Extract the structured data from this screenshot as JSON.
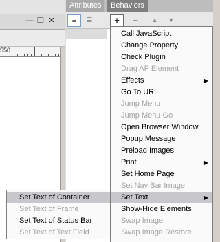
{
  "document_window": {
    "ruler_label": "550"
  },
  "window_controls": {
    "minimize": "—",
    "restore": "❐",
    "close": "✕"
  },
  "panel": {
    "tabs": [
      {
        "label": "Attributes"
      },
      {
        "label": "Behaviors"
      }
    ],
    "toolbar": {
      "show_set_events_icon": "≡",
      "show_all_events_icon": "≣",
      "add_behavior": "+",
      "remove_behavior": "–",
      "move_up": "▲",
      "move_down": "▼"
    }
  },
  "behaviors_menu": {
    "items": [
      {
        "label": "Call JavaScript",
        "disabled": false,
        "has_submenu": false
      },
      {
        "label": "Change Property",
        "disabled": false,
        "has_submenu": false
      },
      {
        "label": "Check Plugin",
        "disabled": false,
        "has_submenu": false
      },
      {
        "label": "Drag AP Element",
        "disabled": true,
        "has_submenu": false
      },
      {
        "label": "Effects",
        "disabled": false,
        "has_submenu": true
      },
      {
        "label": "Go To URL",
        "disabled": false,
        "has_submenu": false
      },
      {
        "label": "Jump Menu",
        "disabled": true,
        "has_submenu": false
      },
      {
        "label": "Jump Menu Go",
        "disabled": true,
        "has_submenu": false
      },
      {
        "label": "Open Browser Window",
        "disabled": false,
        "has_submenu": false
      },
      {
        "label": "Popup Message",
        "disabled": false,
        "has_submenu": false
      },
      {
        "label": "Preload Images",
        "disabled": false,
        "has_submenu": false
      },
      {
        "label": "Print",
        "disabled": false,
        "has_submenu": true
      },
      {
        "label": "Set Home Page",
        "disabled": false,
        "has_submenu": false
      },
      {
        "label": "Set Nav Bar Image",
        "disabled": true,
        "has_submenu": false
      },
      {
        "label": "Set Text",
        "disabled": false,
        "has_submenu": true,
        "highlighted": true
      },
      {
        "label": "Show-Hide Elements",
        "disabled": false,
        "has_submenu": false
      },
      {
        "label": "Swap Image",
        "disabled": true,
        "has_submenu": false
      },
      {
        "label": "Swap Image Restore",
        "disabled": true,
        "has_submenu": false
      }
    ],
    "submenu_arrow": "▶"
  },
  "set_text_submenu": {
    "items": [
      {
        "label": "Set Text of Container",
        "disabled": false,
        "highlighted": true
      },
      {
        "label": "Set Text of Frame",
        "disabled": true
      },
      {
        "label": "Set Text of Status Bar",
        "disabled": false
      },
      {
        "label": "Set Text of Text Field",
        "disabled": true
      }
    ]
  }
}
